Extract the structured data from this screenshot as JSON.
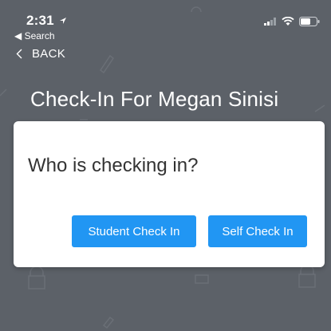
{
  "status_bar": {
    "time": "2:31",
    "back_app": "Search"
  },
  "nav": {
    "back_label": "BACK"
  },
  "page": {
    "title": "Check-In For Megan Sinisi"
  },
  "modal": {
    "question": "Who is checking in?",
    "student_button": "Student Check In",
    "self_button": "Self Check In"
  },
  "colors": {
    "background": "#5c6168",
    "accent": "#2196f3",
    "modal": "#ffffff"
  },
  "icons": [
    "location-arrow-icon",
    "signal-icon",
    "wifi-icon",
    "battery-icon",
    "back-chevron-icon"
  ]
}
